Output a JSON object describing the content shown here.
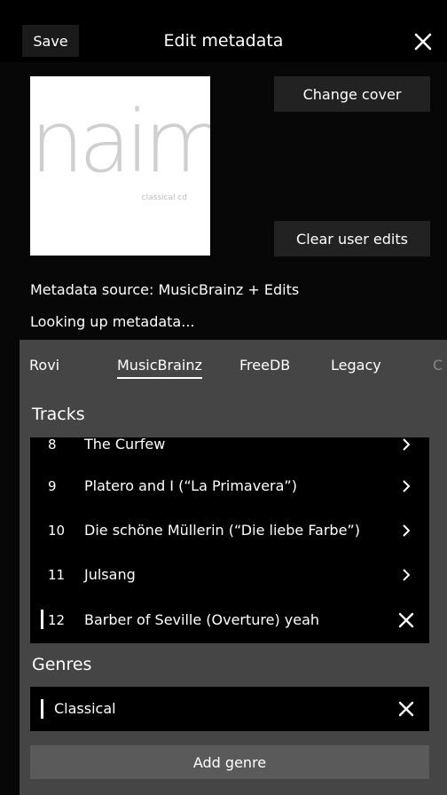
{
  "header": {
    "save_label": "Save",
    "title": "Edit metadata",
    "close_icon": "close-icon"
  },
  "cover": {
    "brand_text": "naim",
    "brand_sub": "classical cd"
  },
  "buttons": {
    "change_cover": "Change cover",
    "clear_edits": "Clear user edits",
    "add_genre": "Add genre"
  },
  "metadata": {
    "source": "Metadata source:  MusicBrainz + Edits",
    "status": "Looking up metadata..."
  },
  "tabs": [
    {
      "label": "Rovi"
    },
    {
      "label": "MusicBrainz",
      "active": true
    },
    {
      "label": "FreeDB"
    },
    {
      "label": "Legacy"
    },
    {
      "label": "C"
    }
  ],
  "tracks": {
    "heading": "Tracks",
    "items": [
      {
        "num": "8",
        "name": "The Curfew",
        "action": "chevron-right-icon"
      },
      {
        "num": "9",
        "name": "Platero and I (“La Primavera”)",
        "action": "chevron-right-icon"
      },
      {
        "num": "10",
        "name": "Die schöne Müllerin (“Die liebe Farbe”)",
        "action": "chevron-right-icon"
      },
      {
        "num": "11",
        "name": "Julsang",
        "action": "chevron-right-icon"
      },
      {
        "num": "12",
        "name": "Barber of Seville (Overture) yeah",
        "action": "close-icon",
        "edited": true
      }
    ]
  },
  "genres": {
    "heading": "Genres",
    "items": [
      {
        "name": "Classical",
        "action": "close-icon",
        "edited": true
      }
    ]
  },
  "colors": {
    "background": "#070707",
    "panel": "#454545",
    "list": "#000000",
    "button": "#222222",
    "add_button": "#5a5a5a"
  }
}
